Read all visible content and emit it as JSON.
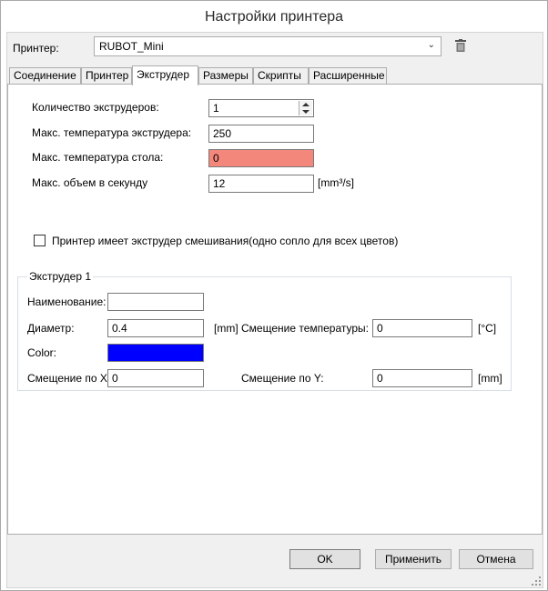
{
  "window": {
    "title": "Настройки принтера"
  },
  "printer": {
    "label": "Принтер:",
    "selected": "RUBOT_Mini"
  },
  "tabs": [
    {
      "label": "Соединение",
      "active": false
    },
    {
      "label": "Принтер",
      "active": false
    },
    {
      "label": "Экструдер",
      "active": true
    },
    {
      "label": "Размеры",
      "active": false
    },
    {
      "label": "Скрипты",
      "active": false
    },
    {
      "label": "Расширенные",
      "active": false
    }
  ],
  "extruder": {
    "count_label": "Количество экструдеров:",
    "count_value": "1",
    "max_temp_label": "Макс. температура экструдера:",
    "max_temp_value": "250",
    "bed_temp_label": "Макс. температура стола:",
    "bed_temp_value": "0",
    "bed_temp_bg": "#f4877c",
    "volume_label": "Макс. объем в секунду",
    "volume_value": "12",
    "volume_unit": "[mm³/s]",
    "mixing_label": "Принтер имеет экструдер смешивания(одно сопло для всех цветов)",
    "mixing_checked": false
  },
  "extruder1": {
    "title": "Экструдер 1",
    "name_label": "Наименование:",
    "name_value": "",
    "diameter_label": "Диаметр:",
    "diameter_value": "0.4",
    "diameter_unit": "[mm]",
    "temp_offset_label": "Смещение температуры:",
    "temp_offset_value": "0",
    "temp_offset_unit": "[°C]",
    "color_label": "Color:",
    "color_value": "#0000ff",
    "offset_x_label": "Смещение по X:",
    "offset_x_value": "0",
    "offset_y_label": "Смещение по Y:",
    "offset_y_value": "0",
    "offset_y_unit": "[mm]"
  },
  "buttons": {
    "ok": "OK",
    "apply": "Применить",
    "cancel": "Отмена"
  },
  "icons": {
    "dropdown": "chevron-down-icon",
    "delete": "trash-icon"
  }
}
